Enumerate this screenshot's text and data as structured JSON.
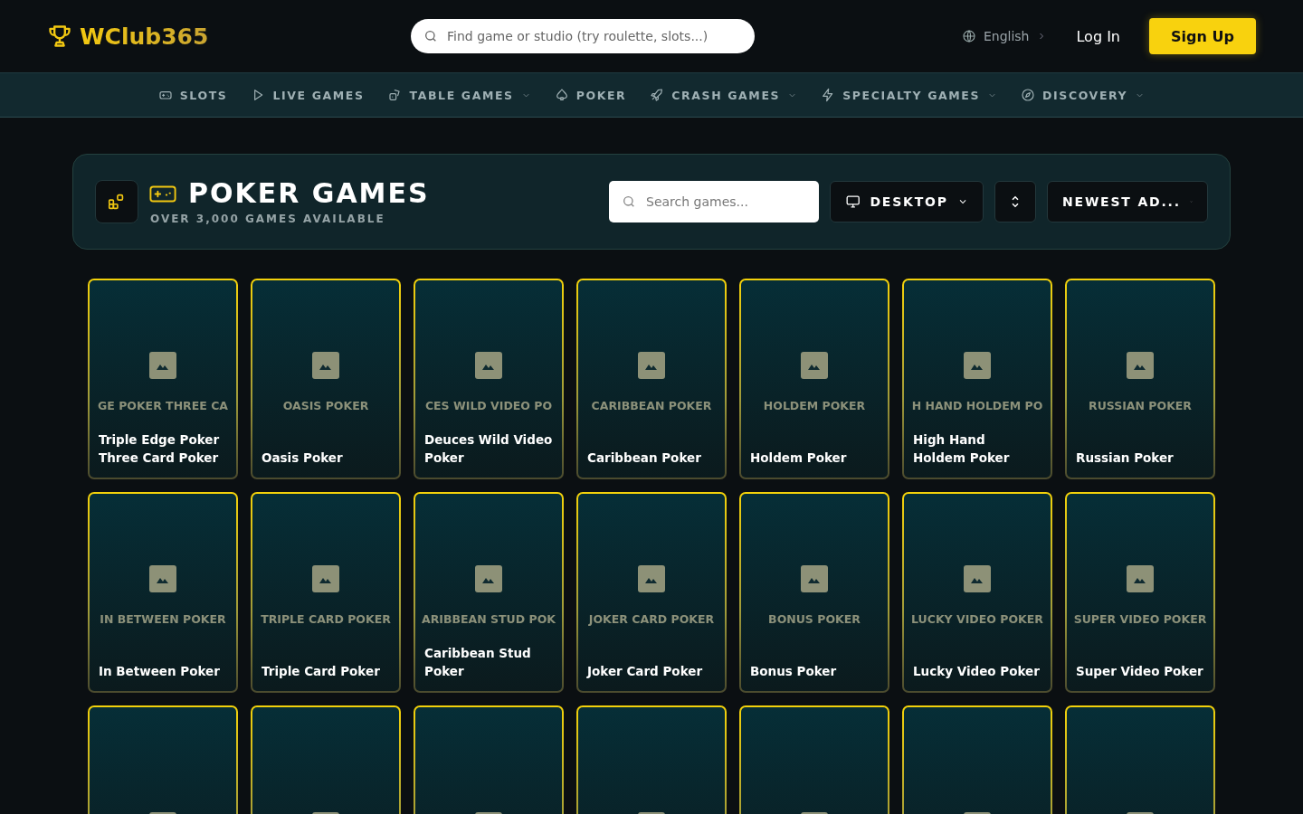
{
  "header": {
    "logo": "WClub365",
    "search": {
      "placeholder": "Find game or studio (try roulette, slots...)"
    },
    "language": "English",
    "login": "Log In",
    "signup": "Sign Up"
  },
  "nav": [
    {
      "kind": "gamepad",
      "label": "SLOTS",
      "dropdown": false
    },
    {
      "kind": "play",
      "label": "LIVE GAMES",
      "dropdown": false
    },
    {
      "kind": "dice",
      "label": "TABLE GAMES",
      "dropdown": true
    },
    {
      "kind": "spade",
      "label": "POKER",
      "dropdown": false
    },
    {
      "kind": "rocket",
      "label": "CRASH GAMES",
      "dropdown": true
    },
    {
      "kind": "bolt",
      "label": "SPECIALTY GAMES",
      "dropdown": true
    },
    {
      "kind": "compass",
      "label": "DISCOVERY",
      "dropdown": true
    }
  ],
  "panel": {
    "title": "POKER GAMES",
    "subtitle": "OVER 3,000 GAMES AVAILABLE",
    "search": {
      "placeholder": "Search games..."
    },
    "device": "DESKTOP",
    "sort": "NEWEST AD..."
  },
  "cards": [
    {
      "kind": "tile",
      "label": "GE POKER THREE CA",
      "title": "Triple Edge Poker Three Card Poker"
    },
    {
      "kind": "tile",
      "label": "OASIS POKER",
      "title": "Oasis Poker"
    },
    {
      "kind": "tile",
      "label": "CES WILD VIDEO PO",
      "title": "Deuces Wild Video Poker"
    },
    {
      "kind": "tile",
      "label": "CARIBBEAN POKER",
      "title": "Caribbean Poker"
    },
    {
      "kind": "tile",
      "label": "HOLDEM POKER",
      "title": "Holdem Poker"
    },
    {
      "kind": "tile",
      "label": "H HAND HOLDEM PO",
      "title": "High Hand Holdem Poker"
    },
    {
      "kind": "tile",
      "label": "RUSSIAN POKER",
      "title": "Russian Poker"
    },
    {
      "kind": "tile",
      "label": "IN BETWEEN POKER",
      "title": "In Between Poker"
    },
    {
      "kind": "tile",
      "label": "TRIPLE CARD POKER",
      "title": "Triple Card Poker"
    },
    {
      "kind": "tile",
      "label": "ARIBBEAN STUD POK",
      "title": "Caribbean Stud Poker"
    },
    {
      "kind": "tile",
      "label": "JOKER CARD POKER",
      "title": "Joker Card Poker"
    },
    {
      "kind": "tile",
      "label": "BONUS POKER",
      "title": "Bonus Poker"
    },
    {
      "kind": "tile",
      "label": "LUCKY VIDEO POKER",
      "title": "Lucky Video Poker"
    },
    {
      "kind": "tile",
      "label": "SUPER VIDEO POKER",
      "title": "Super Video Poker"
    },
    {
      "kind": "tile"
    },
    {
      "kind": "tile"
    },
    {
      "kind": "tile"
    },
    {
      "kind": "tile"
    },
    {
      "kind": "tile"
    },
    {
      "kind": "tile"
    },
    {
      "kind": "tile"
    }
  ]
}
